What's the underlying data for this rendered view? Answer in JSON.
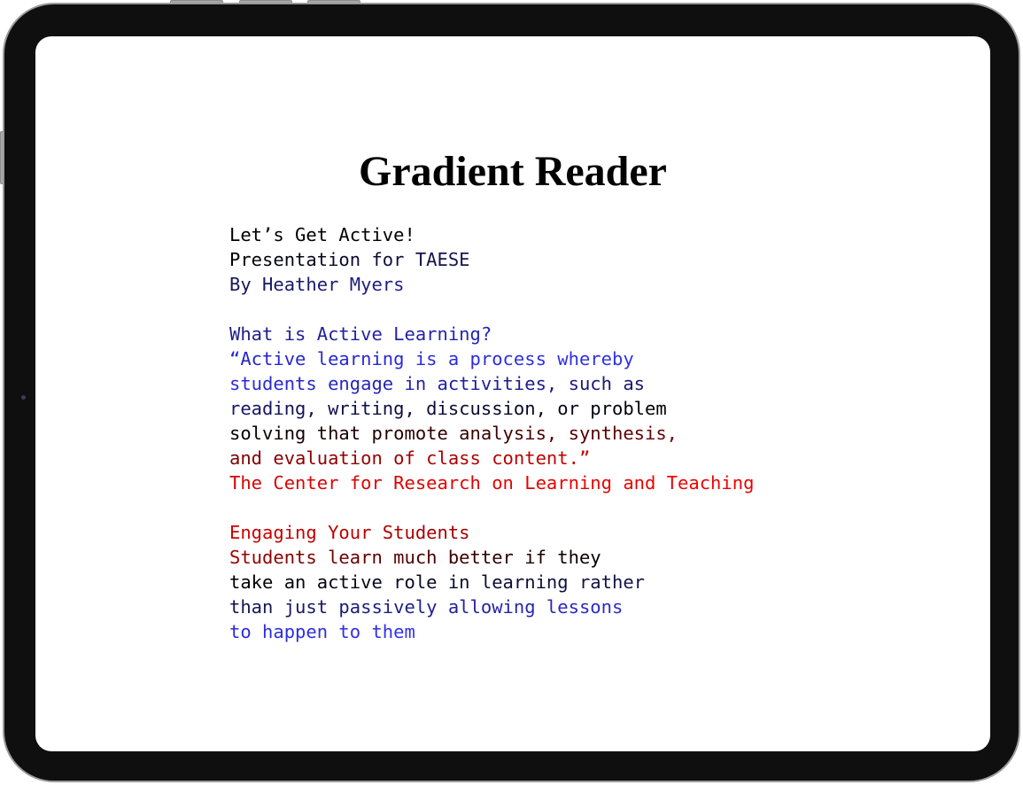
{
  "app": {
    "title": "Gradient Reader"
  },
  "colors": {
    "black": "#000000",
    "navy": "#1a1a6e",
    "blue": "#2020e0",
    "dark_red": "#8b0000",
    "red": "#e00000"
  },
  "reader": {
    "lines": [
      {
        "text": "Let’s Get Active!",
        "from": "#000000",
        "to": "#000000"
      },
      {
        "text": "Presentation for TAESE",
        "from": "#000000",
        "to": "#16165a"
      },
      {
        "text": "By Heather Myers",
        "from": "#16165a",
        "to": "#1e1e88"
      },
      {
        "text": "",
        "from": "#000000",
        "to": "#000000"
      },
      {
        "text": "What is Active Learning?",
        "from": "#1e1e88",
        "to": "#2424b8"
      },
      {
        "text": "“Active learning is a process whereby",
        "from": "#2424c8",
        "to": "#3030e8"
      },
      {
        "text": "students engage in activities, such as",
        "from": "#2a2ae0",
        "to": "#16166a"
      },
      {
        "text": "reading, writing, discussion, or problem",
        "from": "#16166a",
        "to": "#000000"
      },
      {
        "text": "solving that promote analysis, synthesis,",
        "from": "#000000",
        "to": "#6a0000"
      },
      {
        "text": "and evaluation of class content.”",
        "from": "#7a0000",
        "to": "#c80000"
      },
      {
        "text": "The Center for Research on Learning and Teaching",
        "from": "#d80000",
        "to": "#f00000"
      },
      {
        "text": "",
        "from": "#000000",
        "to": "#000000"
      },
      {
        "text": "Engaging Your Students",
        "from": "#d00000",
        "to": "#a00000"
      },
      {
        "text": "Students learn much better if they",
        "from": "#a00000",
        "to": "#000000"
      },
      {
        "text": "take an active role in learning rather",
        "from": "#000000",
        "to": "#14144e"
      },
      {
        "text": "than just passively allowing lessons",
        "from": "#14144e",
        "to": "#2a2ad0"
      },
      {
        "text": "to happen to them",
        "from": "#2a2ad8",
        "to": "#3030f0"
      }
    ]
  }
}
